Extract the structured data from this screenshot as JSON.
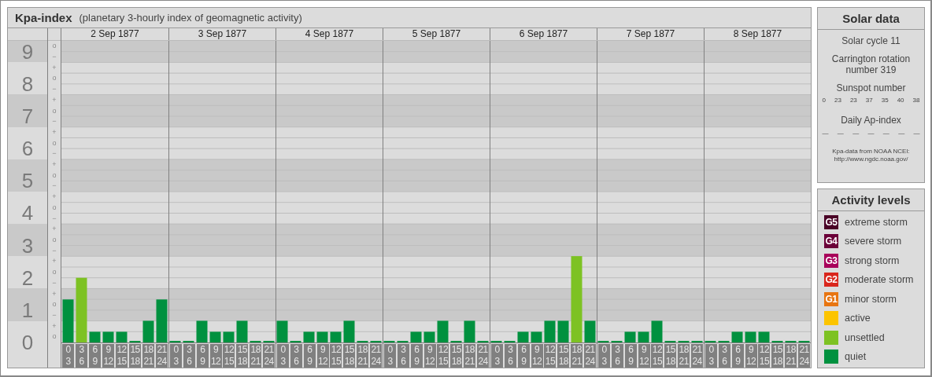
{
  "header": {
    "title": "Kpa-index",
    "subtitle": "(planetary 3-hourly index of geomagnetic activity)"
  },
  "kp_chart": {
    "days": [
      "2 Sep 1877",
      "3 Sep 1877",
      "4 Sep 1877",
      "5 Sep 1877",
      "6 Sep 1877",
      "7 Sep 1877",
      "8 Sep 1877"
    ],
    "subticks": [
      "o",
      "−",
      "+",
      "o",
      "−",
      "+",
      "o",
      "−",
      "+",
      "o",
      "−",
      "+",
      "o",
      "−",
      "+",
      "o",
      "−",
      "+",
      "o",
      "−",
      "+",
      "o",
      "−",
      "+",
      "o",
      "−",
      "+",
      "o"
    ],
    "chart_data": {
      "type": "bar",
      "grid": true,
      "ylim": [
        0,
        9.33
      ],
      "yticks": [
        9,
        8,
        7,
        6,
        5,
        4,
        3,
        2,
        1,
        0
      ],
      "categories": [
        "0 3",
        "3 6",
        "6 9",
        "9 12",
        "12 15",
        "15 18",
        "18 21",
        "21 24",
        "0 3",
        "3 6",
        "6 9",
        "9 12",
        "12 15",
        "15 18",
        "18 21",
        "21 24",
        "0 3",
        "3 6",
        "6 9",
        "9 12",
        "12 15",
        "15 18",
        "18 21",
        "21 24",
        "0 3",
        "3 6",
        "6 9",
        "9 12",
        "12 15",
        "15 18",
        "18 21",
        "21 24",
        "0 3",
        "3 6",
        "6 9",
        "9 12",
        "12 15",
        "15 18",
        "18 21",
        "21 24",
        "0 3",
        "3 6",
        "6 9",
        "9 12",
        "12 15",
        "15 18",
        "18 21",
        "21 24",
        "0 3",
        "3 6",
        "6 9",
        "9 12",
        "12 15",
        "15 18",
        "18 21",
        "21 24"
      ],
      "series": [
        {
          "color": "#00913f",
          "values": [
            1.33,
            null,
            0.33,
            0.33,
            0.33,
            0,
            0.67,
            1.33,
            0,
            0,
            0.67,
            0.33,
            0.33,
            0.67,
            0,
            0,
            0.67,
            0,
            0.33,
            0.33,
            0.33,
            0.67,
            0,
            0,
            0,
            0,
            0.33,
            0.33,
            0.67,
            0,
            0.67,
            0,
            0,
            0,
            0.33,
            0.33,
            0.67,
            0.67,
            null,
            0.67,
            0,
            0,
            0.33,
            0.33,
            0.67,
            0,
            0,
            0,
            0,
            0,
            0.33,
            0.33,
            0.33,
            0,
            0,
            0
          ]
        },
        {
          "color": "#7dc223",
          "values": [
            null,
            2,
            null,
            null,
            null,
            null,
            null,
            null,
            null,
            null,
            null,
            null,
            null,
            null,
            null,
            null,
            null,
            null,
            null,
            null,
            null,
            null,
            null,
            null,
            null,
            null,
            null,
            null,
            null,
            null,
            null,
            null,
            null,
            null,
            null,
            null,
            null,
            null,
            2.67,
            null,
            null,
            null,
            null,
            null,
            null,
            null,
            null,
            null,
            null,
            null,
            null,
            null,
            null,
            null,
            null,
            null
          ]
        }
      ]
    }
  },
  "solar_data": {
    "title": "Solar data",
    "cycle": "Solar cycle 11",
    "rotation": "Carrington rotation number 319",
    "sunspot_label": "Sunspot number",
    "sunspot_numbers": [
      "0",
      "23",
      "23",
      "37",
      "35",
      "40",
      "38"
    ],
    "ap_label": "Daily Ap-index",
    "ap_values": [
      "—",
      "—",
      "—",
      "—",
      "—",
      "—",
      "—"
    ],
    "source": "Kpa-data from NOAA NCEI: http://www.ngdc.noaa.gov/"
  },
  "activity_levels": {
    "title": "Activity levels",
    "items": [
      {
        "badge": "G5",
        "label": "extreme storm",
        "color": "#4a0026"
      },
      {
        "badge": "G4",
        "label": "severe storm",
        "color": "#6b0038"
      },
      {
        "badge": "G3",
        "label": "strong storm",
        "color": "#a8005a"
      },
      {
        "badge": "G2",
        "label": "moderate storm",
        "color": "#d9261c"
      },
      {
        "badge": "G1",
        "label": "minor storm",
        "color": "#e87511"
      },
      {
        "label": "active",
        "color": "#fcc400"
      },
      {
        "label": "unsettled",
        "color": "#7dc223"
      },
      {
        "label": "quiet",
        "color": "#00913f"
      }
    ]
  }
}
